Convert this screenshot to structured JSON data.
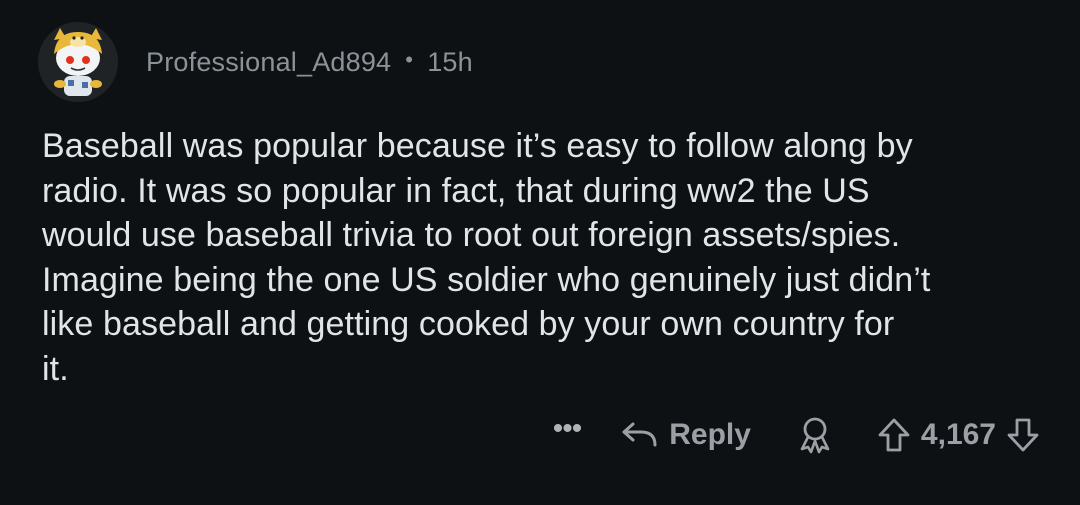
{
  "comment": {
    "author": "Professional_Ad894",
    "separator": "•",
    "age": "15h",
    "avatar_icon": "snoo-avatar-icon",
    "body": "Baseball was popular because it’s easy to follow along by\nradio. It was so popular in fact, that during ww2 the US\nwould use baseball trivia to root out foreign assets/spies.\nImagine being the one US soldier who genuinely just didn’t\nlike baseball and getting cooked by your own country for\nit."
  },
  "actions": {
    "more_label": "•••",
    "reply_label": "Reply",
    "reply_icon": "reply-arrow-icon",
    "award_icon": "award-icon",
    "upvote_icon": "upvote-arrow-icon",
    "score": "4,167",
    "downvote_icon": "downvote-arrow-icon"
  },
  "colors": {
    "background": "#0e1113",
    "text": "#e2e5e7",
    "muted": "#8b9298"
  }
}
